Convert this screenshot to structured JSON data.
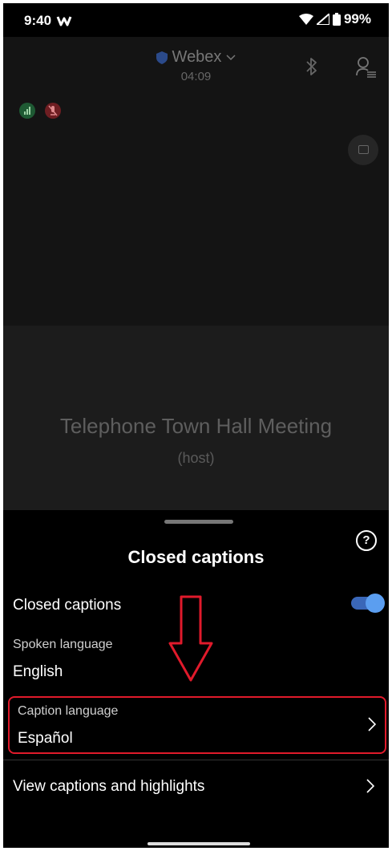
{
  "status_bar": {
    "time": "9:40",
    "battery": "99%"
  },
  "meeting": {
    "app_name": "Webex",
    "timer": "04:09"
  },
  "stage": {
    "title": "Telephone Town Hall Meeting",
    "subtitle": "(host)"
  },
  "sheet": {
    "help_label": "?",
    "title": "Closed captions",
    "closed_captions_label": "Closed captions",
    "closed_captions_enabled": true,
    "spoken_language_label": "Spoken language",
    "spoken_language_value": "English",
    "caption_language_label": "Caption language",
    "caption_language_value": "Español",
    "view_captions_label": "View captions and highlights"
  },
  "colors": {
    "accent": "#5b9ef0",
    "highlight": "#e01a2b"
  }
}
